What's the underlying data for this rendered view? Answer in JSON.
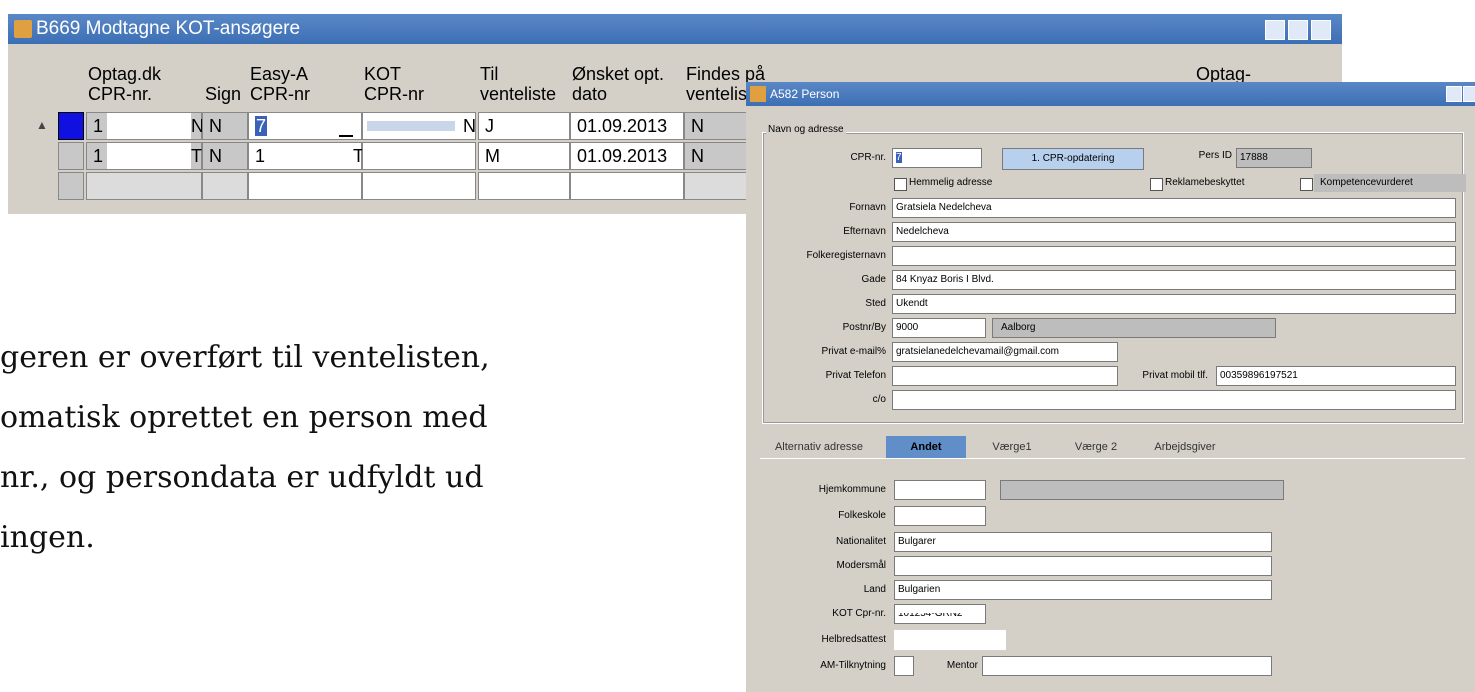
{
  "b669": {
    "title": "B669 Modtagne KOT-ansøgere",
    "headers": {
      "optag_dk": "Optag.dk",
      "cpr_nr": "CPR-nr.",
      "sign": "Sign",
      "easya": "Easy-A",
      "easya_cpr": "CPR-nr",
      "kot": "KOT",
      "kot_cpr": "CPR-nr",
      "til": "Til",
      "venteliste": "venteliste",
      "onsket": "Ønsket opt.",
      "dato": "dato",
      "findes": "Findes på",
      "ventelis": "venteliste",
      "optag": "Optag-"
    },
    "rows": [
      {
        "cpr": "1",
        "cpr_end": "N",
        "sign": "N",
        "easya": "7",
        "kot_end": "N",
        "til": "J",
        "dato": "01.09.2013",
        "findes": "N"
      },
      {
        "cpr": "1",
        "cpr_end": "T",
        "sign": "N",
        "easya": "1",
        "kot_end": "T",
        "til": "M",
        "dato": "01.09.2013",
        "findes": "N"
      }
    ]
  },
  "paragraph": {
    "line1": "geren er overført til ventelisten,",
    "line2": "omatisk oprettet en person med",
    "line3": "nr., og persondata er udfyldt ud",
    "line4": "ingen."
  },
  "a582": {
    "title": "A582 Person",
    "group_label": "Navn og adresse",
    "cpr_label": "CPR-nr.",
    "cpr_value": "7",
    "cpr_button": "1. CPR-opdatering",
    "pers_id_label": "Pers ID",
    "pers_id_value": "17888",
    "hemmelig": "Hemmelig adresse",
    "reklame": "Reklamebeskyttet",
    "kompetence": "Kompetencevurderet",
    "fornavn_label": "Fornavn",
    "fornavn": "Gratsiela Nedelcheva",
    "efternavn_label": "Efternavn",
    "efternavn": "Nedelcheva",
    "folkereg_label": "Folkeregisternavn",
    "folkereg": "",
    "gade_label": "Gade",
    "gade": "84 Knyaz Boris I Blvd.",
    "sted_label": "Sted",
    "sted": "Ukendt",
    "postnr_label": "Postnr/By",
    "postnr": "9000",
    "by": "Aalborg",
    "email_label": "Privat e-mail%",
    "email": "gratsielanedelchevamail@gmail.com",
    "telefon_label": "Privat Telefon",
    "telefon": "",
    "mobil_label": "Privat mobil tlf.",
    "mobil": "00359896197521",
    "co_label": "c/o",
    "co": "",
    "tabs": [
      "Alternativ adresse",
      "Andet",
      "Værge1",
      "Værge 2",
      "Arbejdsgiver"
    ],
    "hjemkommune_label": "Hjemkommune",
    "folkeskole_label": "Folkeskole",
    "nationalitet_label": "Nationalitet",
    "nationalitet": "Bulgarer",
    "modersmaal_label": "Modersmål",
    "land_label": "Land",
    "land": "Bulgarien",
    "kot_cpr_label": "KOT Cpr-nr.",
    "kot_cpr": "101254-GRN2",
    "helbred_label": "Helbredsattest",
    "am_label": "AM-Tilknytning",
    "mentor_label": "Mentor"
  }
}
